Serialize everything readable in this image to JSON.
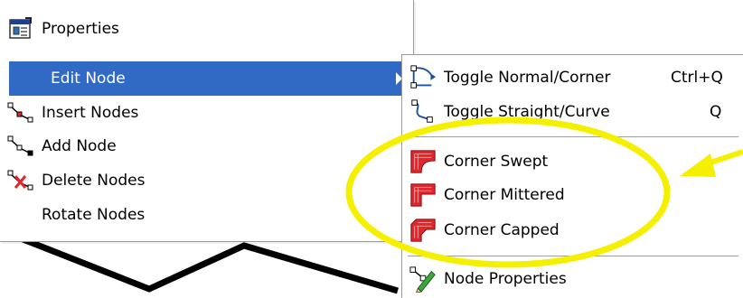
{
  "main_menu": {
    "items": [
      {
        "label": "Properties",
        "icon": "properties-icon"
      },
      {
        "label": "Edit Node",
        "icon": "",
        "highlighted": true,
        "has_submenu": true
      },
      {
        "label": "Insert Nodes",
        "icon": "insert-nodes-icon"
      },
      {
        "label": "Add Node",
        "icon": "add-node-icon"
      },
      {
        "label": "Delete Nodes",
        "icon": "delete-nodes-icon"
      },
      {
        "label": "Rotate Nodes",
        "icon": ""
      }
    ]
  },
  "sub_menu": {
    "items": [
      {
        "label": "Toggle Normal/Corner",
        "shortcut": "Ctrl+Q",
        "icon": "toggle-normal-corner-icon"
      },
      {
        "label": "Toggle Straight/Curve",
        "shortcut": "Q",
        "icon": "toggle-straight-curve-icon"
      },
      {
        "label": "Corner Swept",
        "icon": "corner-swept-icon"
      },
      {
        "label": "Corner Mittered",
        "icon": "corner-mittered-icon"
      },
      {
        "label": "Corner Capped",
        "icon": "corner-capped-icon"
      },
      {
        "label": "Node Properties",
        "icon": "node-properties-icon"
      }
    ]
  },
  "colors": {
    "highlight": "#316ac5",
    "annotation": "#f4f000",
    "corner_icon": "#e2262c"
  }
}
